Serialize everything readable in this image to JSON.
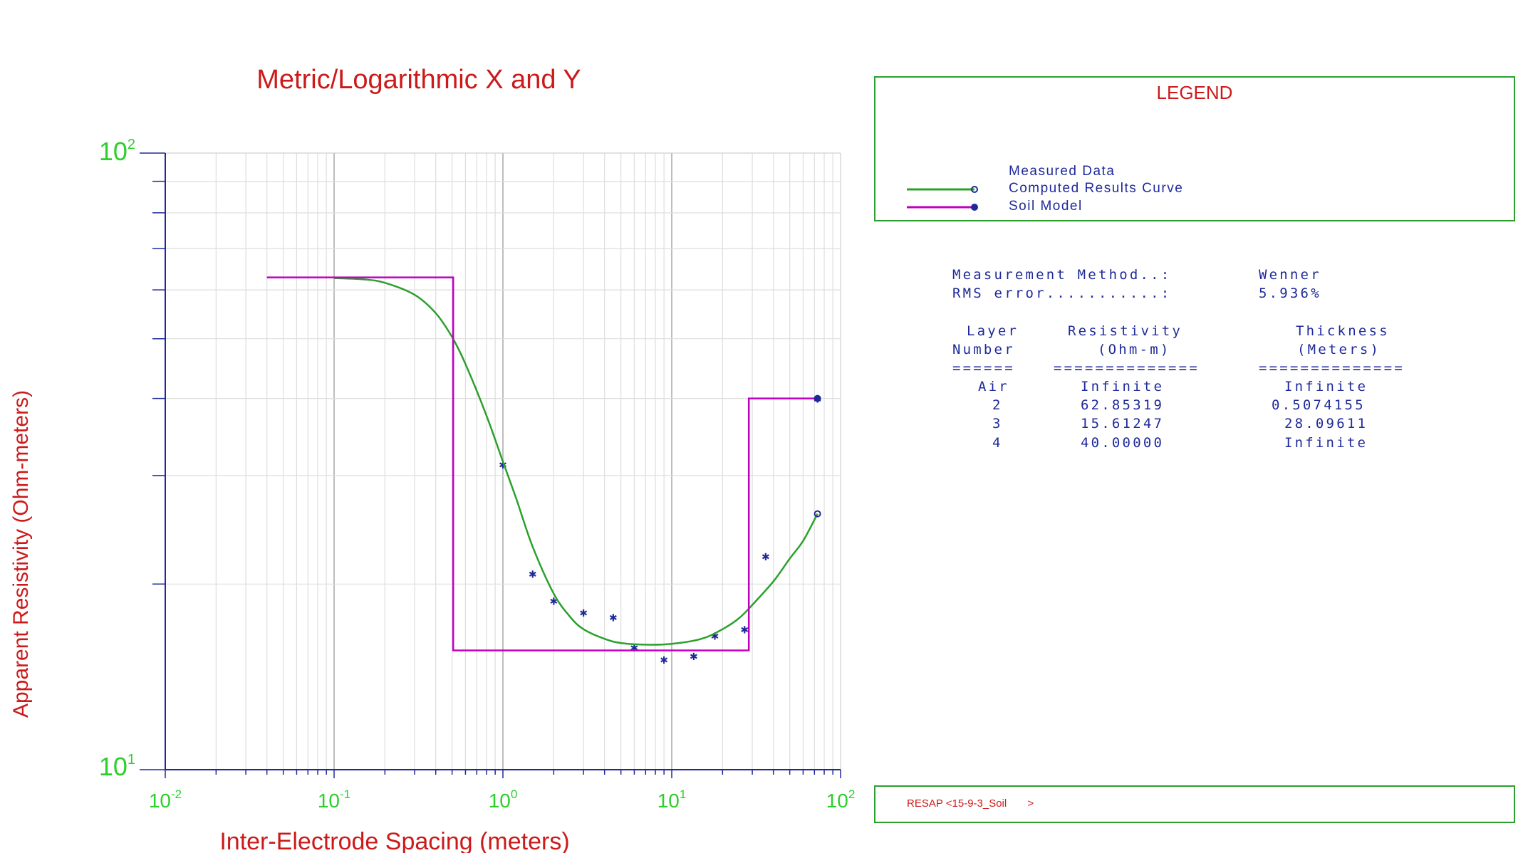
{
  "chart_data": {
    "type": "line",
    "title": "Metric/Logarithmic X and Y",
    "xlabel": "Inter-Electrode Spacing (meters)",
    "ylabel": "Apparent Resistivity (Ohm-meters)",
    "xscale": "log",
    "yscale": "log",
    "xlim": [
      0.01,
      100
    ],
    "ylim": [
      10,
      100
    ],
    "x_tick_labels": [
      "10-2",
      "10-1",
      "100",
      "101",
      "102"
    ],
    "y_tick_labels": [
      "102",
      "101"
    ],
    "grid": true,
    "colors": {
      "measured": "#1f2a9a",
      "computed": "#2ca02c",
      "soil_model": "#c000c0",
      "title": "#cc1a1a",
      "ticks": "#2ccf2c",
      "axes": "#1f2a9a"
    },
    "series": [
      {
        "name": "Measured Data",
        "kind": "scatter",
        "x": [
          1.0,
          1.5,
          2.0,
          3.0,
          4.5,
          6.0,
          9.0,
          13.5,
          18.0,
          27.0,
          36.0,
          73.0
        ],
        "y": [
          31.3,
          20.8,
          18.8,
          18.0,
          17.7,
          15.8,
          15.1,
          15.3,
          16.5,
          16.9,
          22.2,
          40.0
        ]
      },
      {
        "name": "Computed Results Curve",
        "kind": "line",
        "x": [
          0.1,
          0.15,
          0.2,
          0.3,
          0.4,
          0.5,
          0.6,
          0.8,
          1.0,
          1.2,
          1.5,
          2.0,
          2.5,
          3.0,
          4.0,
          5.0,
          7.0,
          10.0,
          15.0,
          20.0,
          25.0,
          30.0,
          40.0,
          50.0,
          60.0,
          73.0
        ],
        "y": [
          62.7,
          62.4,
          61.6,
          58.9,
          55.0,
          50.3,
          45.5,
          37.5,
          31.6,
          27.5,
          23.0,
          19.3,
          17.7,
          16.9,
          16.3,
          16.05,
          15.95,
          16.0,
          16.3,
          16.9,
          17.6,
          18.5,
          20.2,
          22.0,
          23.5,
          26.0
        ]
      },
      {
        "name": "Soil Model",
        "kind": "step",
        "x": [
          0.04,
          0.5074155,
          0.5074155,
          28.6,
          28.6,
          73.0
        ],
        "y": [
          62.85319,
          62.85319,
          15.61247,
          15.61247,
          40.0,
          40.0
        ]
      }
    ]
  },
  "legend": {
    "title": "LEGEND",
    "items": [
      {
        "label": "Measured Data",
        "symbol": "asterisk",
        "color": "#1f2a9a"
      },
      {
        "label": "Computed Results Curve",
        "symbol": "line-circle",
        "color": "#2ca02c"
      },
      {
        "label": "Soil Model",
        "symbol": "line-dot",
        "color": "#c000c0"
      }
    ]
  },
  "info": {
    "method_label": "Measurement Method..:",
    "method_value": "Wenner",
    "rms_label": "RMS error...........:",
    "rms_value": "5.936%",
    "headers": {
      "layer_1": "Layer",
      "layer_2": "Number",
      "res_1": "Resistivity",
      "res_2": "(Ohm-m)",
      "thick_1": "Thickness",
      "thick_2": "(Meters)"
    },
    "separators": [
      "======",
      "==============",
      "=============="
    ],
    "rows": [
      {
        "layer": "Air",
        "resistivity": "Infinite",
        "thickness": "Infinite"
      },
      {
        "layer": "2",
        "resistivity": "62.85319",
        "thickness": "0.5074155"
      },
      {
        "layer": "3",
        "resistivity": "15.61247",
        "thickness": "28.09611"
      },
      {
        "layer": "4",
        "resistivity": "40.00000",
        "thickness": "Infinite"
      }
    ]
  },
  "status": {
    "text": "RESAP <15-9-3_Soil       >"
  }
}
